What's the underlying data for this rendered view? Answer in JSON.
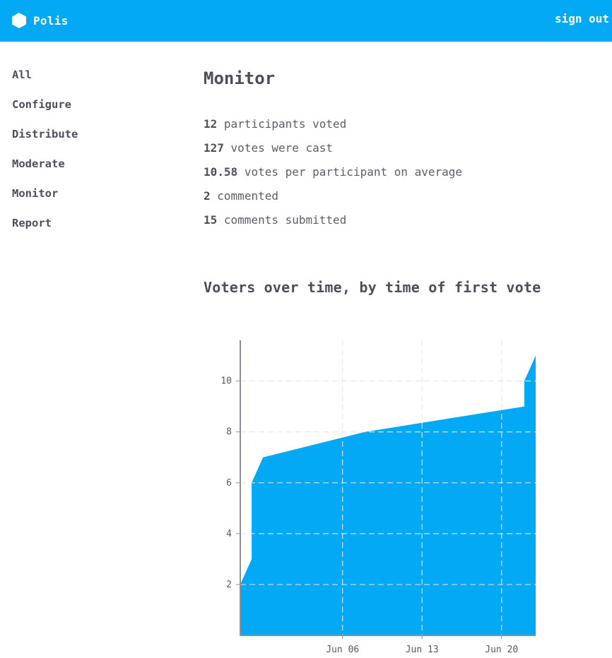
{
  "header": {
    "brand": "Polis",
    "brand_color": "#03a9f4",
    "signout_label": "sign out",
    "logo_icon": "hexagon-icon"
  },
  "sidebar": {
    "items": [
      {
        "label": "All"
      },
      {
        "label": "Configure"
      },
      {
        "label": "Distribute"
      },
      {
        "label": "Moderate"
      },
      {
        "label": "Monitor"
      },
      {
        "label": "Report"
      }
    ]
  },
  "main": {
    "title": "Monitor",
    "stats": [
      {
        "value": "12",
        "text": "participants voted"
      },
      {
        "value": "127",
        "text": "votes were cast"
      },
      {
        "value": "10.58",
        "text": "votes per participant on average"
      },
      {
        "value": "2",
        "text": "commented"
      },
      {
        "value": "15",
        "text": "comments submitted"
      }
    ],
    "chart_title": "Voters over time, by time of first vote"
  },
  "chart_data": {
    "type": "area",
    "title": "Voters over time, by time of first vote",
    "xlabel": "",
    "ylabel": "",
    "x_start": "May 28",
    "x_end": "Jun 23",
    "x_ticks": [
      "Jun 06",
      "Jun 13",
      "Jun 20"
    ],
    "y_ticks": [
      "2",
      "4",
      "6",
      "8",
      "10"
    ],
    "ylim": [
      0,
      11.6
    ],
    "grid": true,
    "fill_color": "#03a9f4",
    "points": [
      {
        "x": "May 28",
        "y": 1
      },
      {
        "x": "May 28",
        "y": 2
      },
      {
        "x": "May 29",
        "y": 3
      },
      {
        "x": "May 29",
        "y": 5
      },
      {
        "x": "May 29",
        "y": 6
      },
      {
        "x": "May 30",
        "y": 7
      },
      {
        "x": "Jun 08",
        "y": 8
      },
      {
        "x": "Jun 22",
        "y": 9
      },
      {
        "x": "Jun 22",
        "y": 10
      },
      {
        "x": "Jun 23",
        "y": 11
      }
    ]
  }
}
